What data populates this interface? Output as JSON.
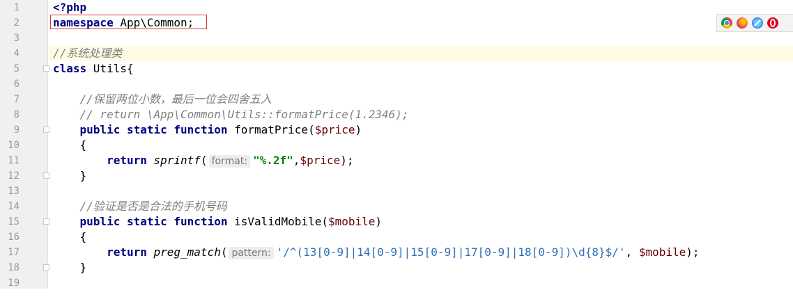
{
  "editor": {
    "line_numbers": [
      "1",
      "2",
      "3",
      "4",
      "5",
      "6",
      "7",
      "8",
      "9",
      "10",
      "11",
      "12",
      "13",
      "14",
      "15",
      "16",
      "17",
      "18",
      "19"
    ],
    "lines": {
      "l1": {
        "tag": "<?php"
      },
      "l2": {
        "kw": "namespace",
        "rest": " App\\Common;"
      },
      "l4": {
        "comment": "//系统处理类"
      },
      "l5": {
        "kw": "class",
        "rest": " Utils{"
      },
      "l7": {
        "comment": "    //保留两位小数，最后一位会四舍五入"
      },
      "l8": {
        "comment": "    // return \\App\\Common\\Utils::formatPrice(1.2346);"
      },
      "l9": {
        "indent": "    ",
        "kw1": "public",
        "kw2": "static",
        "kw3": "function",
        "name": " formatPrice(",
        "var": "$price",
        "close": ")"
      },
      "l10": {
        "text": "    {"
      },
      "l11": {
        "indent": "        ",
        "kw": "return",
        "fn": " sprintf",
        "open": "(",
        "hint": "format:",
        "str": "\"%.2f\"",
        "sep": ",",
        "var": "$price",
        "close": ");"
      },
      "l12": {
        "text": "    }"
      },
      "l14": {
        "comment": "    //验证是否是合法的手机号码"
      },
      "l15": {
        "indent": "    ",
        "kw1": "public",
        "kw2": "static",
        "kw3": "function",
        "name": " isValidMobile(",
        "var": "$mobile",
        "close": ")"
      },
      "l16": {
        "text": "    {"
      },
      "l17": {
        "indent": "        ",
        "kw": "return",
        "fn": " preg_match",
        "open": "(",
        "hint": "pattern:",
        "str": "'/^(13[0-9]|14[0-9]|15[0-9]|17[0-9]|18[0-9])\\d{8}$/'",
        "sep": ", ",
        "var": "$mobile",
        "close": ");"
      },
      "l18": {
        "text": "    }"
      }
    }
  },
  "browser_icons": [
    "chrome-icon",
    "firefox-icon",
    "safari-icon",
    "opera-icon"
  ],
  "colors": {
    "keyword": "#000080",
    "comment": "#808080",
    "variable": "#660000",
    "string": "#008000",
    "highlight_box": "#dd3333",
    "current_line": "#fffae3"
  }
}
